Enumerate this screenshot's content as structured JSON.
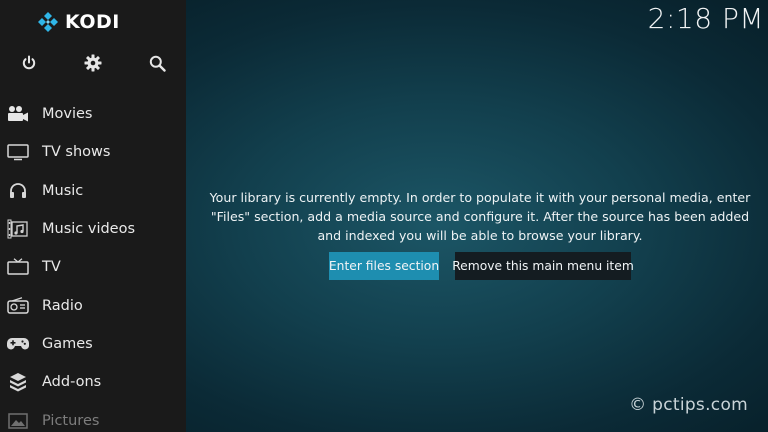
{
  "app": {
    "logo_text": "KODI"
  },
  "clock": {
    "time": "2:18 PM"
  },
  "top_icons": [
    {
      "name": "power-icon"
    },
    {
      "name": "gear-icon"
    },
    {
      "name": "search-icon"
    }
  ],
  "menu": {
    "items": [
      {
        "label": "Movies",
        "icon": "movies-icon"
      },
      {
        "label": "TV shows",
        "icon": "tv-shows-icon"
      },
      {
        "label": "Music",
        "icon": "headphones-icon"
      },
      {
        "label": "Music videos",
        "icon": "music-videos-icon"
      },
      {
        "label": "TV",
        "icon": "tv-icon"
      },
      {
        "label": "Radio",
        "icon": "radio-icon"
      },
      {
        "label": "Games",
        "icon": "gamepad-icon"
      },
      {
        "label": "Add-ons",
        "icon": "addons-icon"
      },
      {
        "label": "Pictures",
        "icon": "pictures-icon"
      }
    ]
  },
  "main": {
    "message": "Your library is currently empty. In order to populate it with your personal media, enter \"Files\" section, add a media source and configure it. After the source has been added and indexed you will be able to browse your library.",
    "primary_button": "Enter files section",
    "secondary_button": "Remove this main menu item"
  },
  "watermark": "© pctips.com",
  "colors": {
    "accent": "#1e8eb0",
    "sidebar_bg": "#1a1a1a",
    "background": "#123f4d"
  }
}
